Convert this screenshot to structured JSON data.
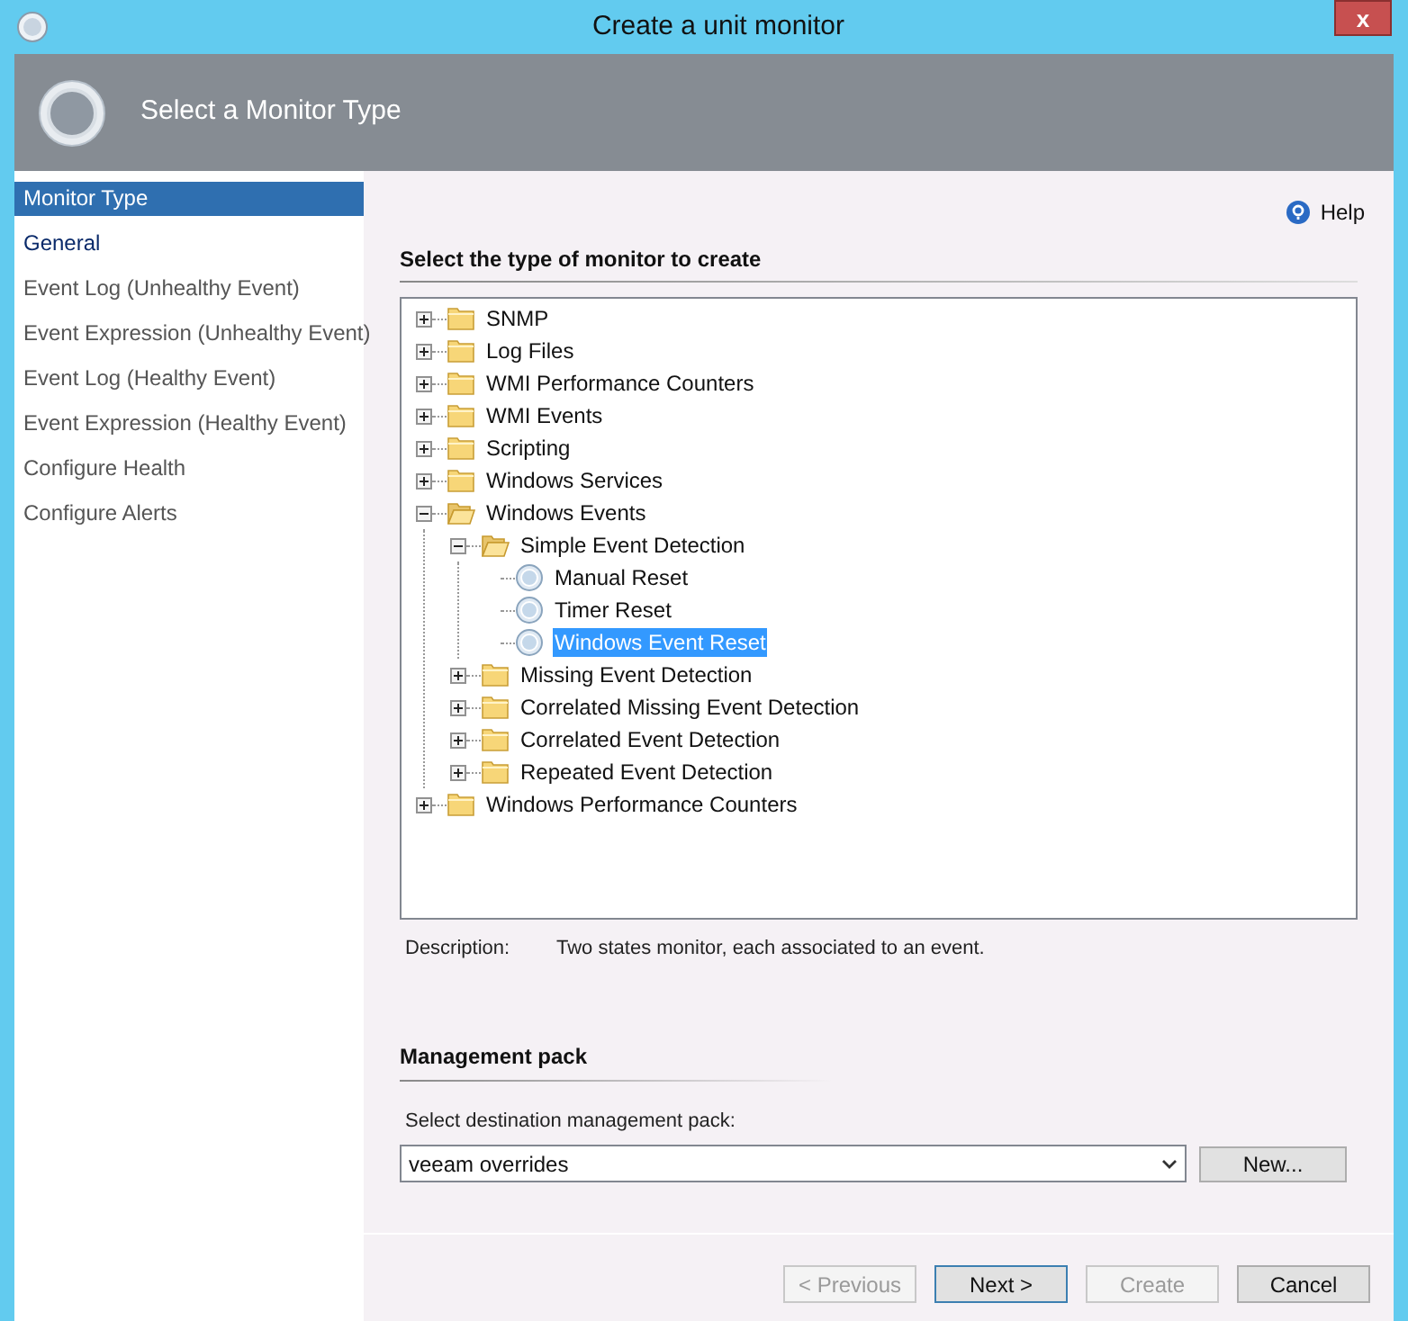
{
  "window": {
    "title": "Create a unit monitor",
    "close_label": "x"
  },
  "header": {
    "title": "Select a Monitor Type"
  },
  "sidebar": {
    "items": [
      {
        "label": "Monitor Type",
        "selected": true,
        "highlighted": false
      },
      {
        "label": "General",
        "selected": false,
        "highlighted": true
      },
      {
        "label": "Event Log (Unhealthy Event)",
        "selected": false,
        "highlighted": false
      },
      {
        "label": "Event Expression (Unhealthy Event)",
        "selected": false,
        "highlighted": false
      },
      {
        "label": "Event Log (Healthy Event)",
        "selected": false,
        "highlighted": false
      },
      {
        "label": "Event Expression (Healthy Event)",
        "selected": false,
        "highlighted": false
      },
      {
        "label": "Configure Health",
        "selected": false,
        "highlighted": false
      },
      {
        "label": "Configure Alerts",
        "selected": false,
        "highlighted": false
      }
    ]
  },
  "help": {
    "label": "Help"
  },
  "section_title": "Select the type of monitor to create",
  "tree": [
    {
      "label": "SNMP",
      "kind": "folder",
      "expanded": false,
      "selected": false
    },
    {
      "label": "Log Files",
      "kind": "folder",
      "expanded": false,
      "selected": false
    },
    {
      "label": "WMI Performance Counters",
      "kind": "folder",
      "expanded": false,
      "selected": false
    },
    {
      "label": "WMI Events",
      "kind": "folder",
      "expanded": false,
      "selected": false
    },
    {
      "label": "Scripting",
      "kind": "folder",
      "expanded": false,
      "selected": false
    },
    {
      "label": "Windows Services",
      "kind": "folder",
      "expanded": false,
      "selected": false
    },
    {
      "label": "Windows Events",
      "kind": "folder",
      "expanded": true,
      "selected": false,
      "children": [
        {
          "label": "Simple Event Detection",
          "kind": "folder",
          "expanded": true,
          "selected": false,
          "children": [
            {
              "label": "Manual Reset",
              "kind": "monitor",
              "selected": false
            },
            {
              "label": "Timer Reset",
              "kind": "monitor",
              "selected": false
            },
            {
              "label": "Windows Event Reset",
              "kind": "monitor",
              "selected": true
            }
          ]
        },
        {
          "label": "Missing Event Detection",
          "kind": "folder",
          "expanded": false,
          "selected": false
        },
        {
          "label": "Correlated Missing Event Detection",
          "kind": "folder",
          "expanded": false,
          "selected": false
        },
        {
          "label": "Correlated Event Detection",
          "kind": "folder",
          "expanded": false,
          "selected": false
        },
        {
          "label": "Repeated Event Detection",
          "kind": "folder",
          "expanded": false,
          "selected": false
        }
      ]
    },
    {
      "label": "Windows Performance Counters",
      "kind": "folder",
      "expanded": false,
      "selected": false
    }
  ],
  "description": {
    "label": "Description:",
    "text": "Two states monitor, each associated to an event."
  },
  "management_pack": {
    "title": "Management pack",
    "label": "Select destination management pack:",
    "value": "veeam overrides",
    "new_button": "New..."
  },
  "buttons": [
    {
      "label": "< Previous",
      "disabled": true,
      "default": false
    },
    {
      "label": "Next >",
      "disabled": false,
      "default": true
    },
    {
      "label": "Create",
      "disabled": true,
      "default": false
    },
    {
      "label": "Cancel",
      "disabled": false,
      "default": false
    }
  ]
}
